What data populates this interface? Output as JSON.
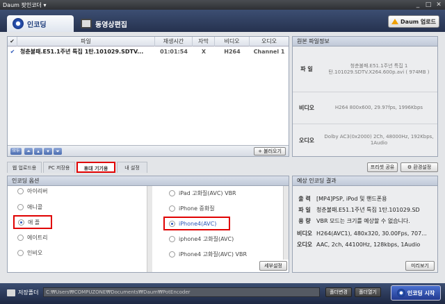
{
  "window": {
    "title": "Daum 팟인코더 ▾",
    "controls": [
      "_",
      "□",
      "✕"
    ]
  },
  "top": {
    "tab_encode": "인코딩",
    "tab_edit": "동영상편집",
    "daum_upload": "Daum 업로드"
  },
  "files": {
    "headers": {
      "check": "✔",
      "file": "파일",
      "duration": "재생시간",
      "subtitle": "자막",
      "video": "비디오",
      "audio": "오디오"
    },
    "row": {
      "check": "✔",
      "file": "청춘불패.E51.1주년 특집 1탄.101029.SDTV...",
      "duration": "01:01:54",
      "subtitle": "X",
      "video": "H264",
      "audio": "Channel 1"
    },
    "toolbar": {
      "small_label": "모두",
      "open": "+ 불러오기"
    }
  },
  "source_info": {
    "title": "원본 파일정보",
    "file_label": "파 일",
    "file_value": "청춘불패.E51.1주년 특집 1탄.101029.SDTV.X264.600p.avi ( 974MB )",
    "video_label": "비디오",
    "video_value": "H264 800x600, 29.97fps, 1996Kbps",
    "audio_label": "오디오",
    "audio_value": "Dolby AC3(0x2000) 2Ch, 48000Hz, 192Kbps, 1Audio"
  },
  "mid_tabs": [
    "웹 업로드용",
    "PC 저장용",
    "휴대 기기용",
    "내 설정"
  ],
  "mid_buttons": {
    "preset_share": "프리셋 공유",
    "env_settings": "환경설정"
  },
  "options": {
    "title": "인코딩 옵션",
    "left": [
      {
        "label": "아이리버",
        "selected": false
      },
      {
        "label": "애니콜",
        "selected": false
      },
      {
        "label": "애 플",
        "selected": true
      },
      {
        "label": "에이트리",
        "selected": false
      },
      {
        "label": "인비오",
        "selected": false
      }
    ],
    "right": [
      {
        "label": "iPad 고화질(AVC) VBR",
        "selected": false
      },
      {
        "label": "iPhone 중화질",
        "selected": false
      },
      {
        "label": "iPhone4(AVC)",
        "selected": true
      },
      {
        "label": "iphone4 고화질(AVC)",
        "selected": false
      },
      {
        "label": "iPhone4 고화질(AVC) VBR",
        "selected": false
      }
    ],
    "detail_button": "세부설정"
  },
  "result": {
    "title": "예상 인코딩 결과",
    "rows": [
      {
        "label": "출 력",
        "value": "[MP4]PSP, iPod 및 핸드폰용"
      },
      {
        "label": "파 일",
        "value": "청춘불패.E51.1주년 특집 1탄.101029.SD"
      },
      {
        "label": "용 량",
        "value": "VBR 모드는 크기를 예상할 수 없습니다."
      },
      {
        "label": "비디오",
        "value": "H264(AVC1), 480x320, 30.00Fps, 707..."
      },
      {
        "label": "오디오",
        "value": "AAC, 2ch, 44100Hz, 128kbps, 1Audio"
      }
    ],
    "preview": "미리보기"
  },
  "bottom": {
    "save_folder": "저장폴더",
    "path": "C:₩Users₩COMPUZONE₩Documents₩Daum₩PotEncoder",
    "change_folder": "폴더변경",
    "open_folder": "폴더열기",
    "start": "인코딩 시작"
  }
}
